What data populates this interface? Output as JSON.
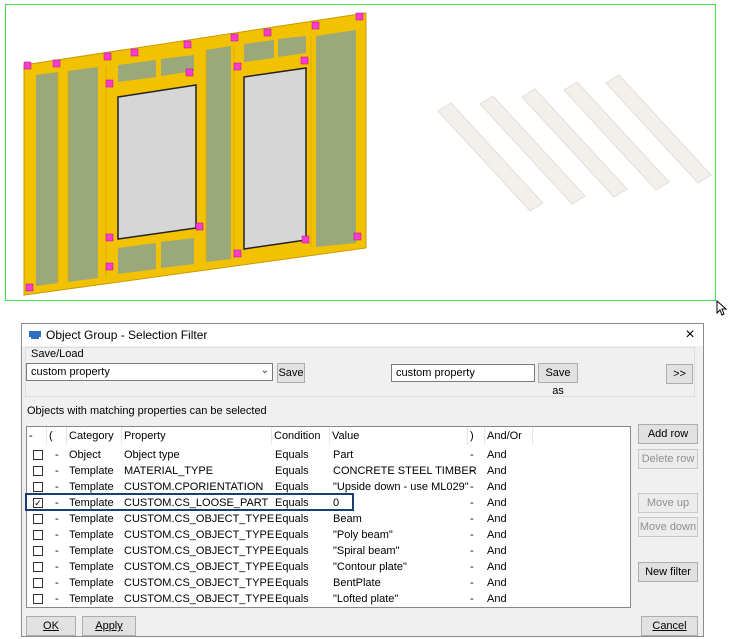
{
  "dialog": {
    "title": "Object Group - Selection Filter",
    "close_glyph": "×",
    "saveload_label": "Save/Load",
    "preset_value": "custom property",
    "save_button": "Save",
    "saveas_input_value": "custom property",
    "saveas_button": "Save as",
    "expand_button": ">>",
    "info_text": "Objects with matching properties can be selected",
    "columns": [
      "-",
      "(",
      "Category",
      "Property",
      "Condition",
      "Value",
      ")",
      "And/Or"
    ],
    "rows": [
      {
        "checked": false,
        "dash": "-",
        "category": "Object",
        "property": "Object type",
        "condition": "Equals",
        "value": "Part",
        "paren": "-",
        "andor": "And"
      },
      {
        "checked": false,
        "dash": "-",
        "category": "Template",
        "property": "MATERIAL_TYPE",
        "condition": "Equals",
        "value": "CONCRETE STEEL TIMBER",
        "paren": "-",
        "andor": "And"
      },
      {
        "checked": false,
        "dash": "-",
        "category": "Template",
        "property": "CUSTOM.CPORIENTATION",
        "condition": "Equals",
        "value": "\"Upside down - use ML029\"",
        "paren": "-",
        "andor": "And"
      },
      {
        "checked": true,
        "dash": "-",
        "category": "Template",
        "property": "CUSTOM.CS_LOOSE_PART",
        "condition": "Equals",
        "value": "0",
        "paren": "-",
        "andor": "And"
      },
      {
        "checked": false,
        "dash": "-",
        "category": "Template",
        "property": "CUSTOM.CS_OBJECT_TYPE",
        "condition": "Equals",
        "value": "Beam",
        "paren": "-",
        "andor": "And"
      },
      {
        "checked": false,
        "dash": "-",
        "category": "Template",
        "property": "CUSTOM.CS_OBJECT_TYPE",
        "condition": "Equals",
        "value": "\"Poly beam\"",
        "paren": "-",
        "andor": "And"
      },
      {
        "checked": false,
        "dash": "-",
        "category": "Template",
        "property": "CUSTOM.CS_OBJECT_TYPE",
        "condition": "Equals",
        "value": "\"Spiral beam\"",
        "paren": "-",
        "andor": "And"
      },
      {
        "checked": false,
        "dash": "-",
        "category": "Template",
        "property": "CUSTOM.CS_OBJECT_TYPE",
        "condition": "Equals",
        "value": "\"Contour plate\"",
        "paren": "-",
        "andor": "And"
      },
      {
        "checked": false,
        "dash": "-",
        "category": "Template",
        "property": "CUSTOM.CS_OBJECT_TYPE",
        "condition": "Equals",
        "value": "BentPlate",
        "paren": "-",
        "andor": "And"
      },
      {
        "checked": false,
        "dash": "-",
        "category": "Template",
        "property": "CUSTOM.CS_OBJECT_TYPE",
        "condition": "Equals",
        "value": "\"Lofted plate\"",
        "paren": "-",
        "andor": "And"
      }
    ],
    "side_buttons": {
      "add_row": "Add row",
      "delete_row": "Delete row",
      "move_up": "Move up",
      "move_down": "Move down",
      "new_filter": "New filter"
    },
    "footer": {
      "ok": "OK",
      "apply": "Apply",
      "cancel": "Cancel"
    }
  },
  "colors": {
    "selection_outline": "#3ee04b",
    "frame_yellow": "#f2c200",
    "panel_green": "#9aa87a",
    "highlight_border": "#1a3e6e"
  },
  "icons": [
    "object-group-icon",
    "close-icon",
    "dropdown-arrow-icon",
    "mouse-cursor-icon"
  ]
}
